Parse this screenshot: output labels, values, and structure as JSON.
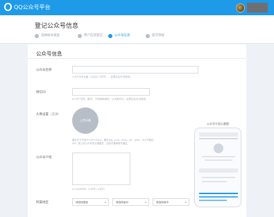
{
  "topbar": {
    "logo_text": "QQ公众号平台",
    "user_name": ""
  },
  "header": {
    "title": "登记公众号信息",
    "steps": [
      {
        "label": "选择帐号类型"
      },
      {
        "label": "用户信息登记"
      },
      {
        "label": "公众号信息"
      },
      {
        "label": "提交审核"
      }
    ],
    "active_step_index": 2
  },
  "form": {
    "section_title": "公众号信息",
    "fields": {
      "name_label": "公众号名称",
      "name_hint": "2-8个汉字长度（1汉字=2字节），且提交后不可修改。",
      "id_label": "微信ID",
      "id_hint": "6-20个字符，数字、下划线和减号，以字母开头，且提交后无法修改。",
      "avatar_label": "头像设置",
      "avatar_optional": "（选填）",
      "avatar_circle_text": "上传头像",
      "avatar_hint_1": "建议尺寸不低于120*120px，格式jpg、png、bmp、gif，jpeg、大小不超过",
      "avatar_hint_2": "2M。请上传公众号的头像图片，否则头像审核不通过。",
      "intro_label": "公众号介绍",
      "intro_hint": "4-120字节中（1字节=1汉字）",
      "region_label": "所属地区"
    },
    "region_selects": [
      {
        "value": "请选择国家"
      },
      {
        "value": "请选择省份"
      },
      {
        "value": "请选择城市"
      }
    ]
  },
  "preview": {
    "title": "公众号介绍示意图"
  }
}
